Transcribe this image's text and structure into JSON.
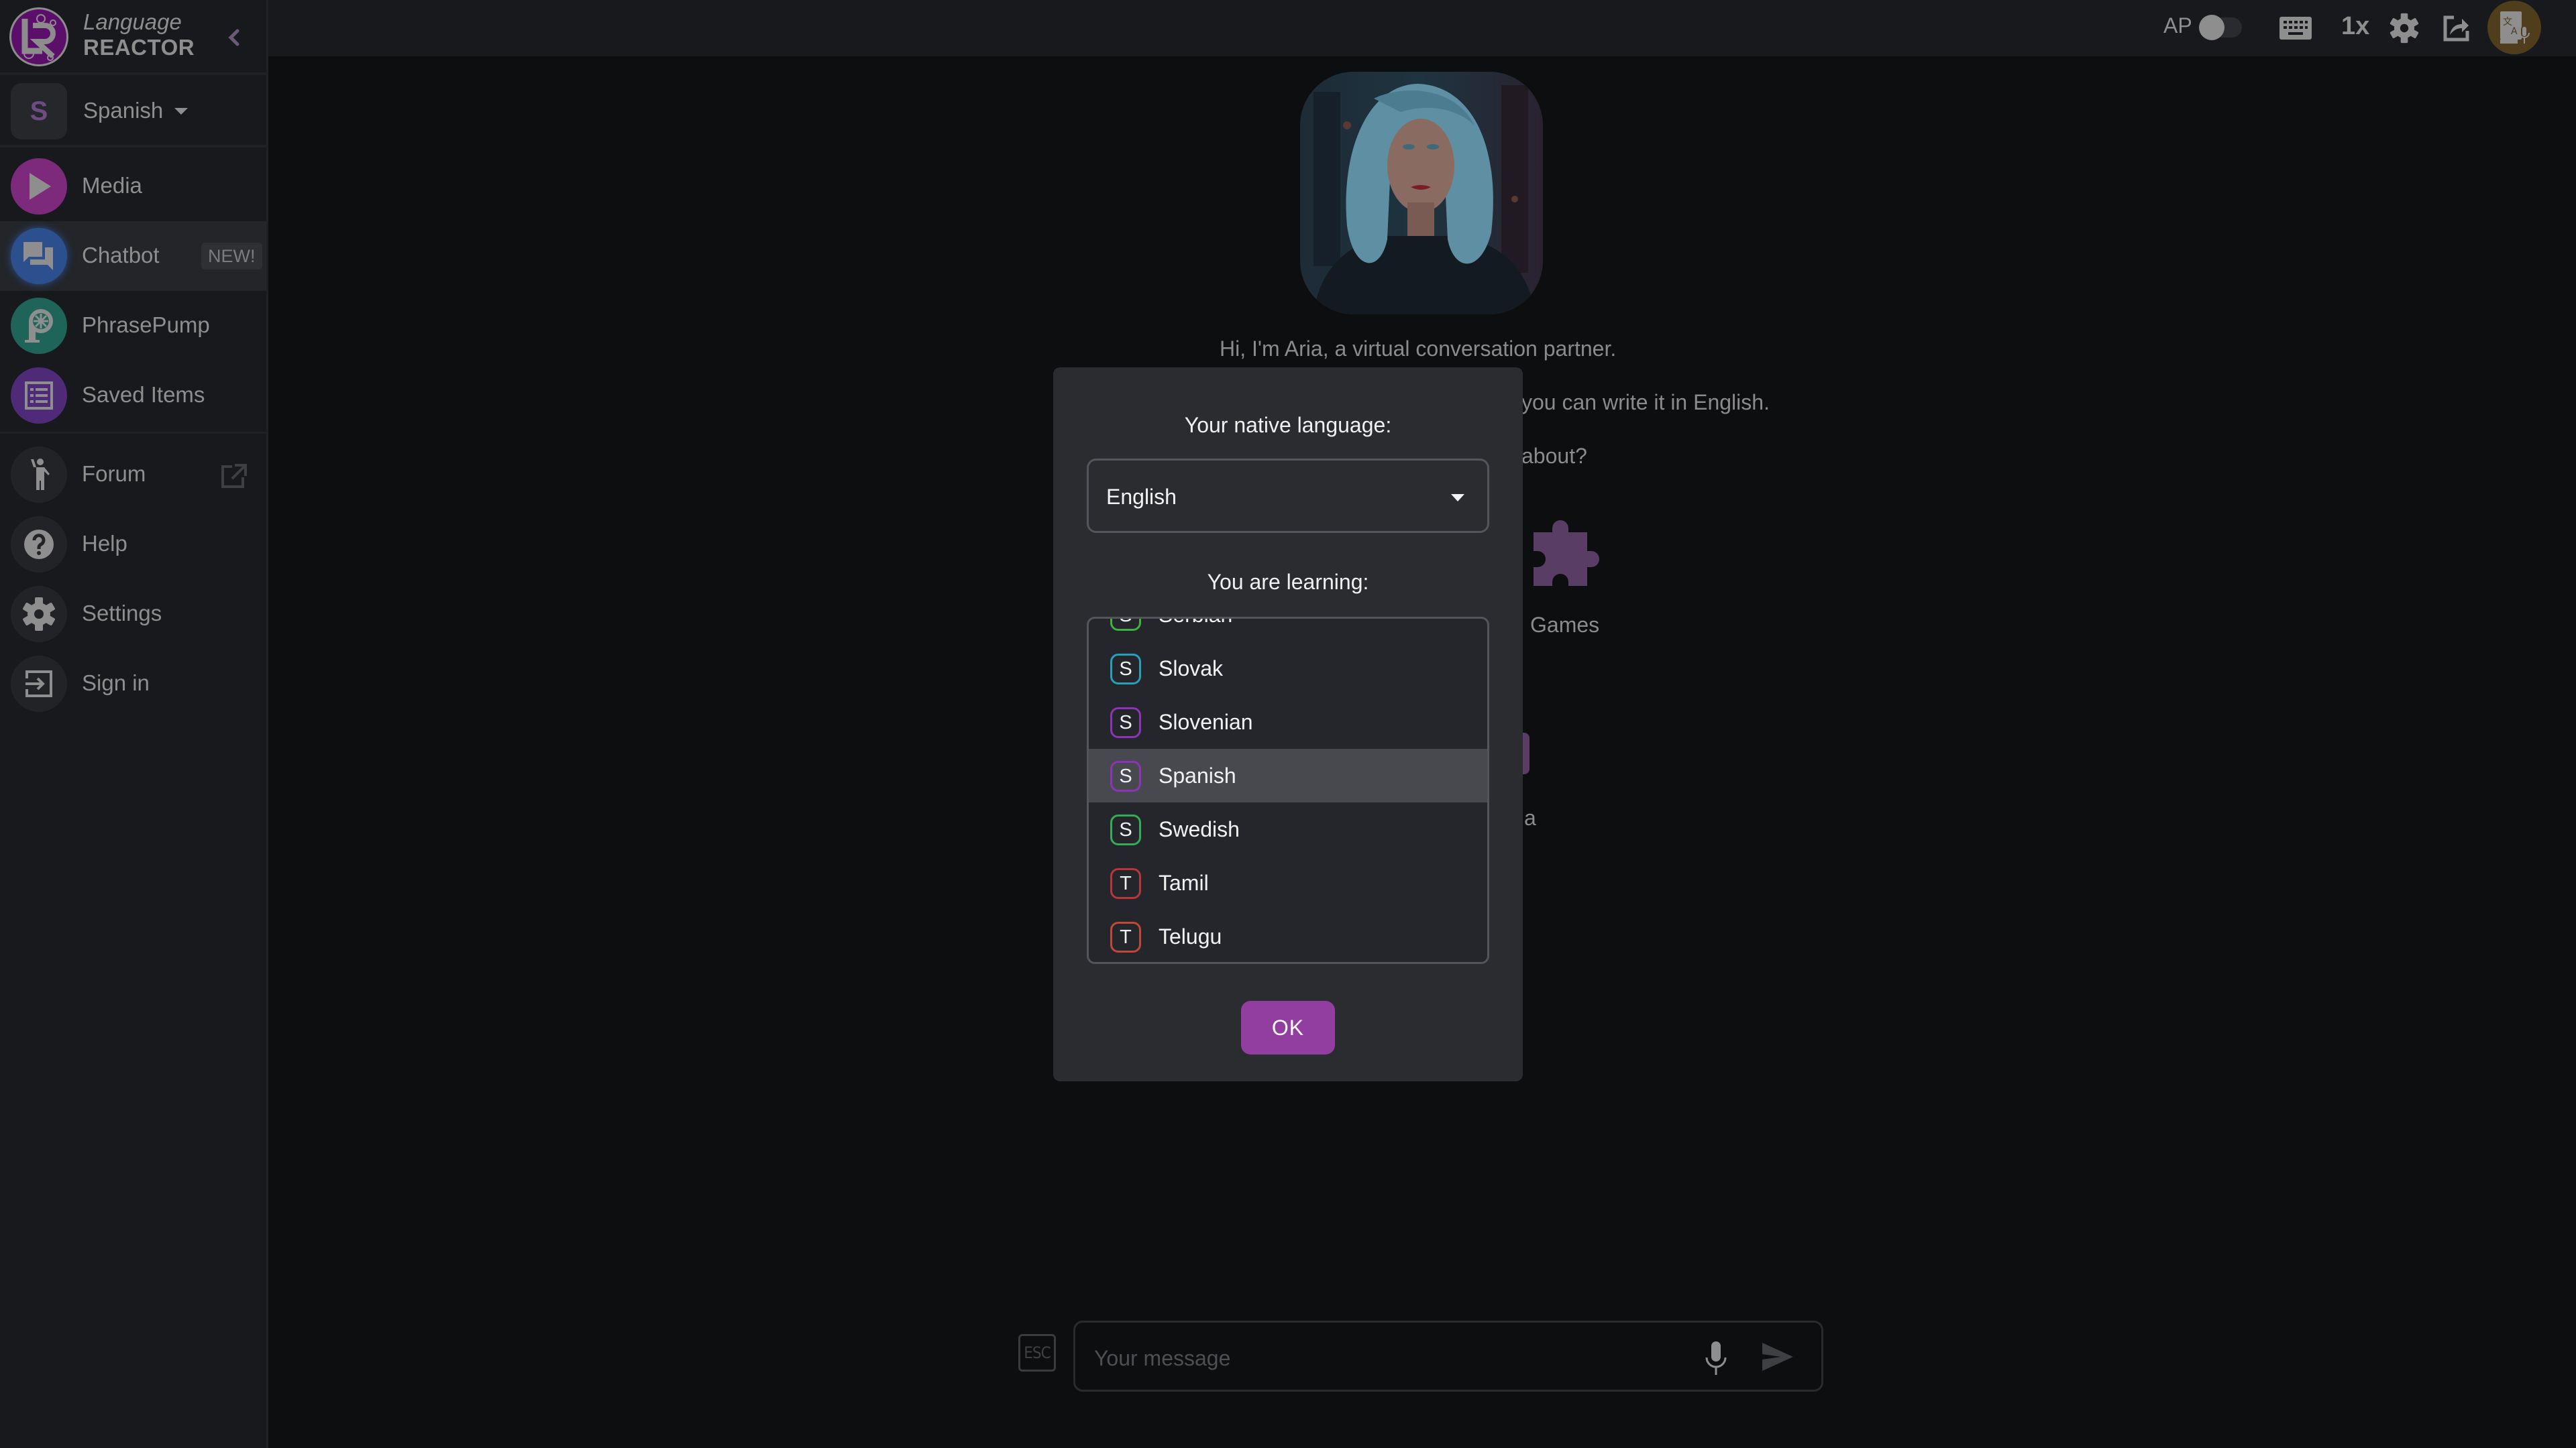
{
  "app": {
    "logo_top": "Language",
    "logo_bottom": "REACTOR"
  },
  "sidebar": {
    "language": {
      "badge": "S",
      "name": "Spanish"
    },
    "items": [
      {
        "id": "media",
        "label": "Media",
        "icon": "play-icon",
        "color": "#8a2a86"
      },
      {
        "id": "chatbot",
        "label": "Chatbot",
        "icon": "chat-icon",
        "color": "#2d5aa8",
        "badge": "NEW!",
        "active": true
      },
      {
        "id": "phrasepump",
        "label": "PhrasePump",
        "icon": "phrasepump-icon",
        "color": "#1f6a5e"
      },
      {
        "id": "saved-items",
        "label": "Saved Items",
        "icon": "list-icon",
        "color": "#5b2f86"
      },
      {
        "id": "forum",
        "label": "Forum",
        "icon": "person-waving-icon",
        "external": true
      },
      {
        "id": "help",
        "label": "Help",
        "icon": "help-icon"
      },
      {
        "id": "settings",
        "label": "Settings",
        "icon": "gear-icon"
      },
      {
        "id": "sign-in",
        "label": "Sign in",
        "icon": "sign-in-icon"
      }
    ]
  },
  "topbar": {
    "autopause_label": "AP",
    "autopause_on": false,
    "speed_label": "1x"
  },
  "chat": {
    "intro_lines": [
      "Hi, I'm Aria, a virtual conversation partner.",
      "you can write it in English.",
      "about?"
    ],
    "features": [
      {
        "label": "Games",
        "icon": "puzzle-icon"
      },
      {
        "label": "a",
        "icon": "partial-icon"
      }
    ],
    "esc_label": "ESC",
    "message_placeholder": "Your message"
  },
  "modal": {
    "native_label": "Your native language:",
    "native_value": "English",
    "learning_label": "You are learning:",
    "languages": [
      {
        "letter": "S",
        "name": "Serbian",
        "color": "#3fb23f"
      },
      {
        "letter": "S",
        "name": "Slovak",
        "color": "#2aa0b8"
      },
      {
        "letter": "S",
        "name": "Slovenian",
        "color": "#8a35b5"
      },
      {
        "letter": "S",
        "name": "Spanish",
        "color": "#8a35b5",
        "selected": true
      },
      {
        "letter": "S",
        "name": "Swedish",
        "color": "#36ab58"
      },
      {
        "letter": "T",
        "name": "Tamil",
        "color": "#b8353b"
      },
      {
        "letter": "T",
        "name": "Telugu",
        "color": "#c0483a"
      }
    ],
    "ok_label": "OK",
    "ok_color": "#923da0"
  }
}
